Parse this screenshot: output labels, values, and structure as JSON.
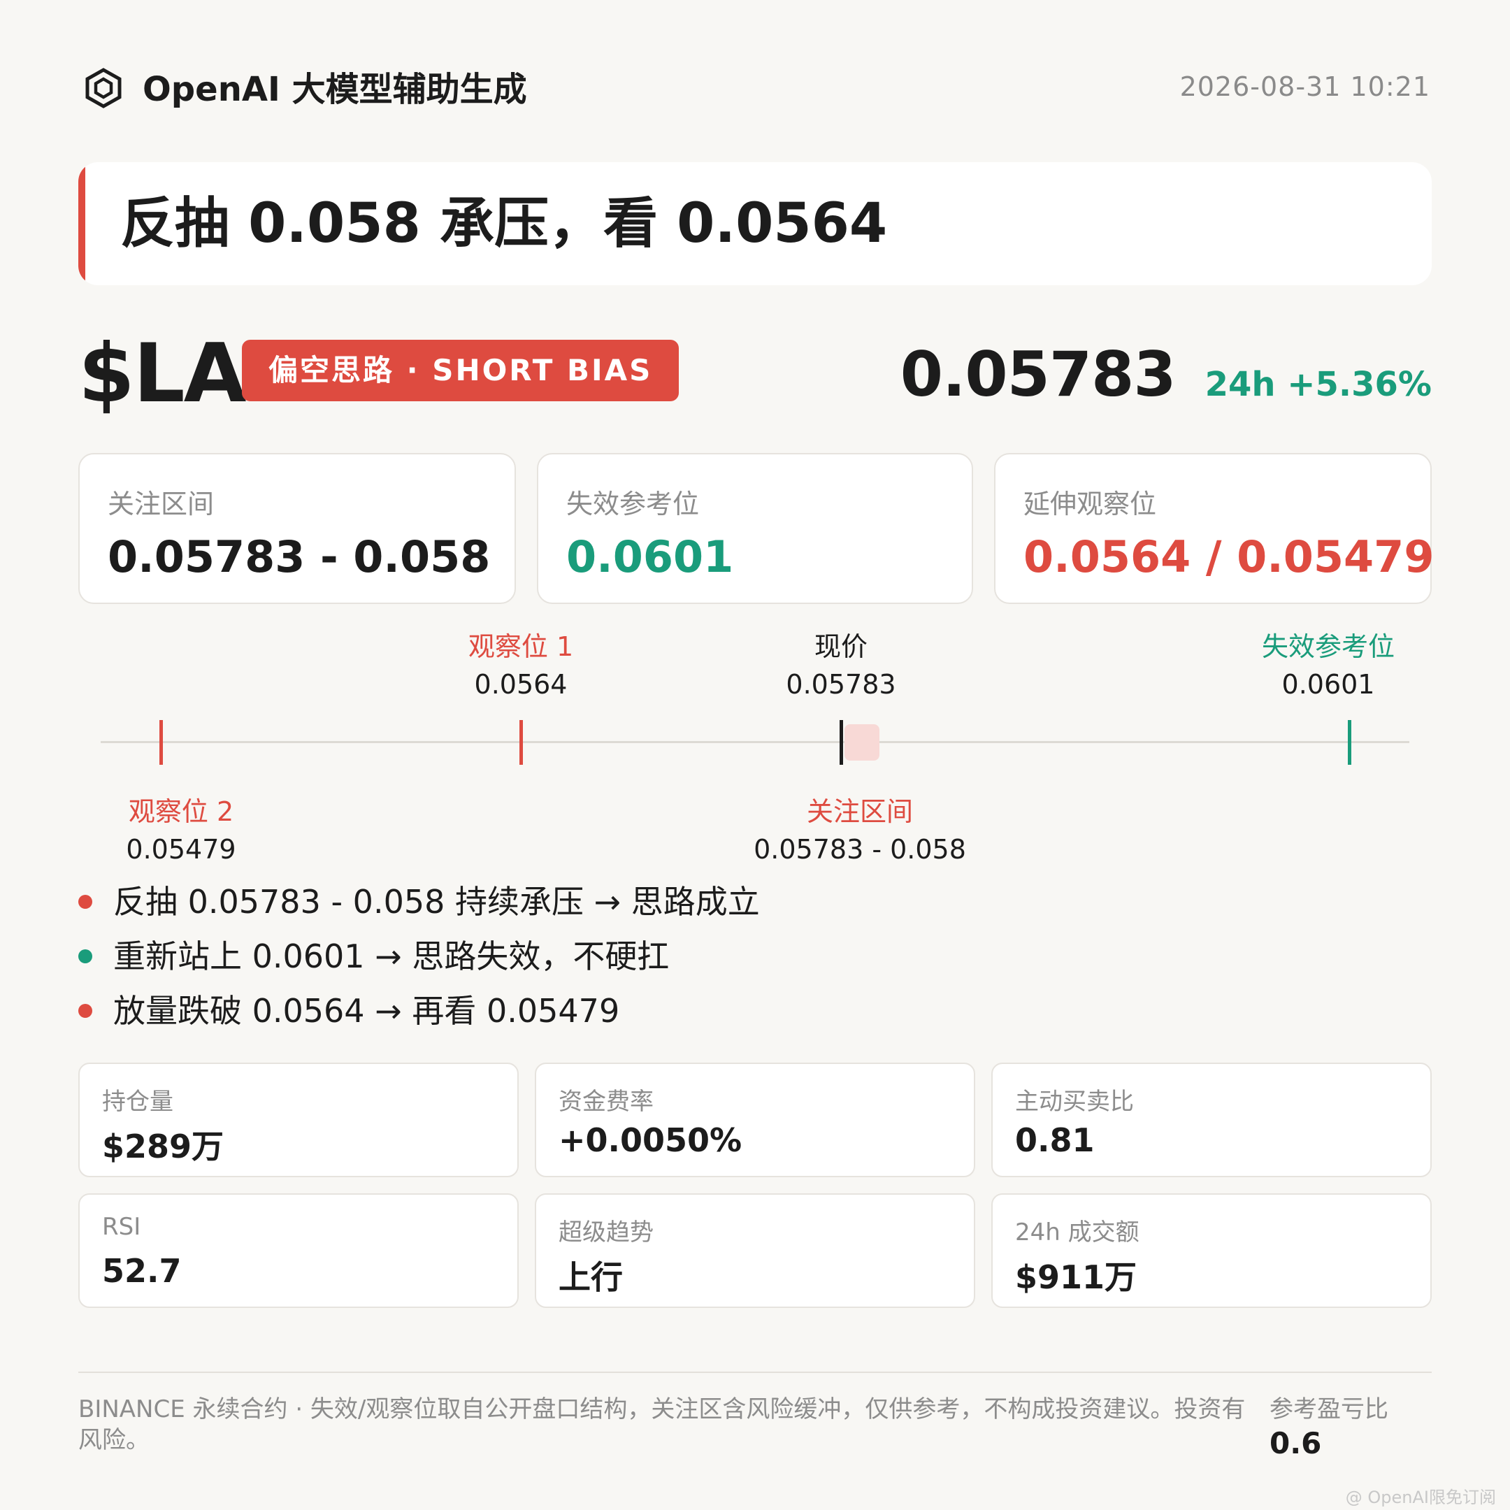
{
  "header": {
    "logo_icon": "hexagon-logo-icon",
    "brand": "OpenAI 大模型辅助生成",
    "timestamp": "2026-08-31 10:21"
  },
  "headline": "反抽 0.058 承压，看 0.0564",
  "ticker": {
    "symbol": "$LA",
    "bias": "偏空思路 · SHORT BIAS",
    "price": "0.05783",
    "change": "24h +5.36%"
  },
  "levels": [
    {
      "label": "关注区间",
      "value": "0.05783 - 0.058",
      "color": "#1c1c1c"
    },
    {
      "label": "失效参考位",
      "value": "0.0601",
      "color": "#1a9c7b"
    },
    {
      "label": "延伸观察位",
      "value": "0.0564 / 0.05479",
      "color": "#de4b40"
    }
  ],
  "level_map": {
    "target1": {
      "label": "观察位 1",
      "value": "0.0564"
    },
    "current": {
      "label": "现价",
      "value": "0.05783"
    },
    "invalidation": {
      "label": "失效参考位",
      "value": "0.0601"
    },
    "target2": {
      "label": "观察位 2",
      "value": "0.05479"
    },
    "zone": {
      "label": "关注区间",
      "value": "0.05783 - 0.058"
    }
  },
  "scenarios": [
    {
      "text": "反抽 0.05783 - 0.058 持续承压 → 思路成立",
      "color": "#de4b40"
    },
    {
      "text": "重新站上 0.0601 → 思路失效，不硬扛",
      "color": "#1a9c7b"
    },
    {
      "text": "放量跌破 0.0564 → 再看 0.05479",
      "color": "#de4b40"
    }
  ],
  "stats": [
    {
      "label": "持仓量",
      "value": "$289万"
    },
    {
      "label": "资金费率",
      "value": "+0.0050%"
    },
    {
      "label": "主动买卖比",
      "value": "0.81"
    },
    {
      "label": "RSI",
      "value": "52.7"
    },
    {
      "label": "超级趋势",
      "value": "上行"
    },
    {
      "label": "24h 成交额",
      "value": "$911万"
    }
  ],
  "footer": {
    "disclaimer": "BINANCE 永续合约 · 失效/观察位取自公开盘口结构，关注区含风险缓冲，仅供参考，不构成投资建议。投资有风险。",
    "rr_label": "参考盈亏比",
    "rr_value": "0.6"
  },
  "watermark": "@ OpenAI限免订阅",
  "colors": {
    "red": "#de4b40",
    "green": "#1a9c7b",
    "text": "#1c1c1c",
    "muted": "#8c8c8c"
  }
}
